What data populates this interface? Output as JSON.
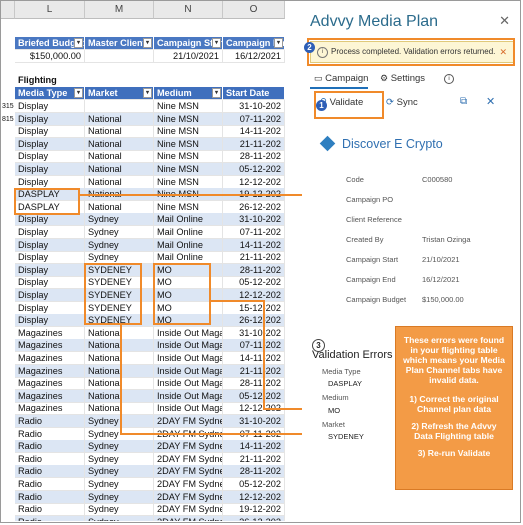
{
  "columns": [
    "L",
    "M",
    "N",
    "O"
  ],
  "summary": {
    "headers": [
      "Briefed Budget",
      "Master Client",
      "Campaign Start",
      "Campaign End"
    ],
    "values": [
      "$150,000.00",
      "",
      "21/10/2021",
      "16/12/2021"
    ]
  },
  "flighting": {
    "label": "Flighting",
    "headers": [
      "Media Type",
      "Market",
      "Medium",
      "Start Date"
    ],
    "left_row_ids": [
      "315",
      "815"
    ],
    "rows": [
      [
        "Display",
        "",
        "Nine MSN",
        "31-10-202"
      ],
      [
        "Display",
        "National",
        "Nine MSN",
        "07-11-202"
      ],
      [
        "Display",
        "National",
        "Nine MSN",
        "14-11-202"
      ],
      [
        "Display",
        "National",
        "Nine MSN",
        "21-11-202"
      ],
      [
        "Display",
        "National",
        "Nine MSN",
        "28-11-202"
      ],
      [
        "Display",
        "National",
        "Nine MSN",
        "05-12-202"
      ],
      [
        "Display",
        "National",
        "Nine MSN",
        "12-12-202"
      ],
      [
        "DASPLAY",
        "National",
        "Nine MSN",
        "19-12-202"
      ],
      [
        "DASPLAY",
        "National",
        "Nine MSN",
        "26-12-202"
      ],
      [
        "Display",
        "Sydney",
        "Mail Online",
        "31-10-202"
      ],
      [
        "Display",
        "Sydney",
        "Mail Online",
        "07-11-202"
      ],
      [
        "Display",
        "Sydney",
        "Mail Online",
        "14-11-202"
      ],
      [
        "Display",
        "Sydney",
        "Mail Online",
        "21-11-202"
      ],
      [
        "Display",
        "SYDENEY",
        "MO",
        "28-11-202"
      ],
      [
        "Display",
        "SYDENEY",
        "MO",
        "05-12-202"
      ],
      [
        "Display",
        "SYDENEY",
        "MO",
        "12-12-202"
      ],
      [
        "Display",
        "SYDENEY",
        "MO",
        "15-12-202"
      ],
      [
        "Display",
        "SYDENEY",
        "MO",
        "26-12-202"
      ],
      [
        "Magazines",
        "National",
        "Inside Out Magazi",
        "31-10-202"
      ],
      [
        "Magazines",
        "National",
        "Inside Out Magazi",
        "07-11-202"
      ],
      [
        "Magazines",
        "National",
        "Inside Out Magazi",
        "14-11-202"
      ],
      [
        "Magazines",
        "National",
        "Inside Out Magazi",
        "21-11-202"
      ],
      [
        "Magazines",
        "National",
        "Inside Out Magazi",
        "28-11-202"
      ],
      [
        "Magazines",
        "National",
        "Inside Out Magazi",
        "05-12-202"
      ],
      [
        "Magazines",
        "National",
        "Inside Out Magazi",
        "12-12-202"
      ],
      [
        "Radio",
        "Sydney",
        "2DAY FM Sydney",
        "31-10-202"
      ],
      [
        "Radio",
        "Sydney",
        "2DAY FM Sydney",
        "07-11-202"
      ],
      [
        "Radio",
        "Sydney",
        "2DAY FM Sydney",
        "14-11-202"
      ],
      [
        "Radio",
        "Sydney",
        "2DAY FM Sydney",
        "21-11-202"
      ],
      [
        "Radio",
        "Sydney",
        "2DAY FM Sydney",
        "28-11-202"
      ],
      [
        "Radio",
        "Sydney",
        "2DAY FM Sydney",
        "05-12-202"
      ],
      [
        "Radio",
        "Sydney",
        "2DAY FM Sydney",
        "12-12-202"
      ],
      [
        "Radio",
        "Sydney",
        "2DAY FM Sydney",
        "19-12-202"
      ],
      [
        "Radio",
        "Sydney",
        "2DAY FM Sydney",
        "26-12-202"
      ]
    ]
  },
  "pane": {
    "title": "Advvy Media Plan",
    "close": "✕",
    "notice": "Process completed. Validation errors returned.",
    "notice_close": "✕",
    "tabs": {
      "campaign": "Campaign",
      "settings": "Settings"
    },
    "toolbar": {
      "validate": "Validate",
      "sync": "Sync"
    },
    "record": {
      "title": "Discover E Crypto",
      "fields": [
        {
          "label": "Code",
          "value": "C000580"
        },
        {
          "label": "Campaign PO",
          "value": ""
        },
        {
          "label": "Client Reference",
          "value": ""
        },
        {
          "label": "Created By",
          "value": "Tristan Ozinga"
        },
        {
          "label": "Campaign Start",
          "value": "21/10/2021"
        },
        {
          "label": "Campaign End",
          "value": "16/12/2021"
        },
        {
          "label": "Campaign Budget",
          "value": "$150,000.00"
        }
      ]
    },
    "validation": {
      "title": "Validation Errors",
      "groups": [
        {
          "label": "Media Type",
          "value": "DASPLAY"
        },
        {
          "label": "Medium",
          "value": "MO"
        },
        {
          "label": "Market",
          "value": "SYDENEY"
        }
      ]
    }
  },
  "badges": [
    "1",
    "2",
    "3"
  ],
  "callout": {
    "intro": "These errors were found in your flighting table which means your Media Plan Channel tabs have invalid data.",
    "steps": [
      "1) Correct the original Channel plan data",
      "2) Refresh the Advvy Data Flighting table",
      "3) Re-run Validate"
    ]
  },
  "colors": {
    "accent": "#2f6fb0",
    "highlight": "#f08a2a",
    "callout": "#f39b46",
    "table_header": "#3f6fbd"
  }
}
